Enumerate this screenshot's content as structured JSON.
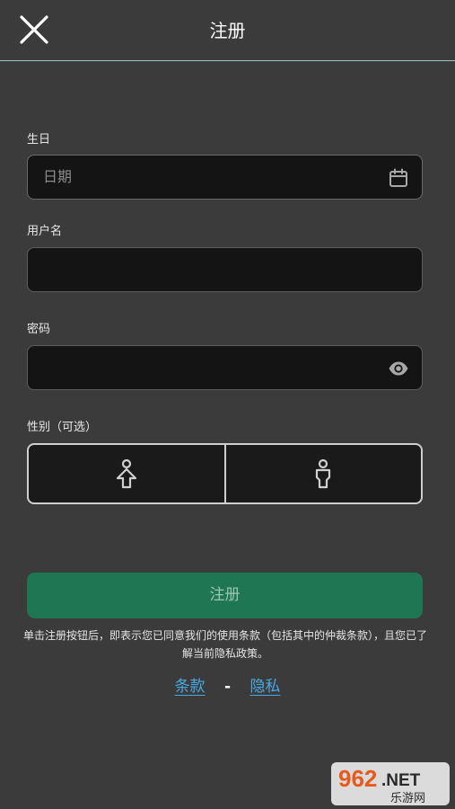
{
  "header": {
    "title": "注册"
  },
  "form": {
    "birthday": {
      "label": "生日",
      "placeholder": "日期"
    },
    "username": {
      "label": "用户名",
      "value": ""
    },
    "password": {
      "label": "密码",
      "value": ""
    },
    "gender": {
      "label": "性别（可选）",
      "options": [
        "male-icon",
        "female-icon"
      ]
    },
    "submit_label": "注册"
  },
  "disclaimer": "单击注册按钮后，即表示您已同意我们的使用条款（包括其中的仲裁条款），且您已了解当前隐私政策。",
  "links": {
    "terms": "条款",
    "separator": "-",
    "privacy": "隐私"
  },
  "watermark": {
    "line1": "962.NET",
    "line2": "乐游网"
  },
  "colors": {
    "background": "#3b3b3b",
    "input_background": "#141414",
    "primary_button": "#1e7653",
    "link": "#4aa8e0",
    "header_divider": "#9fc8cf"
  }
}
